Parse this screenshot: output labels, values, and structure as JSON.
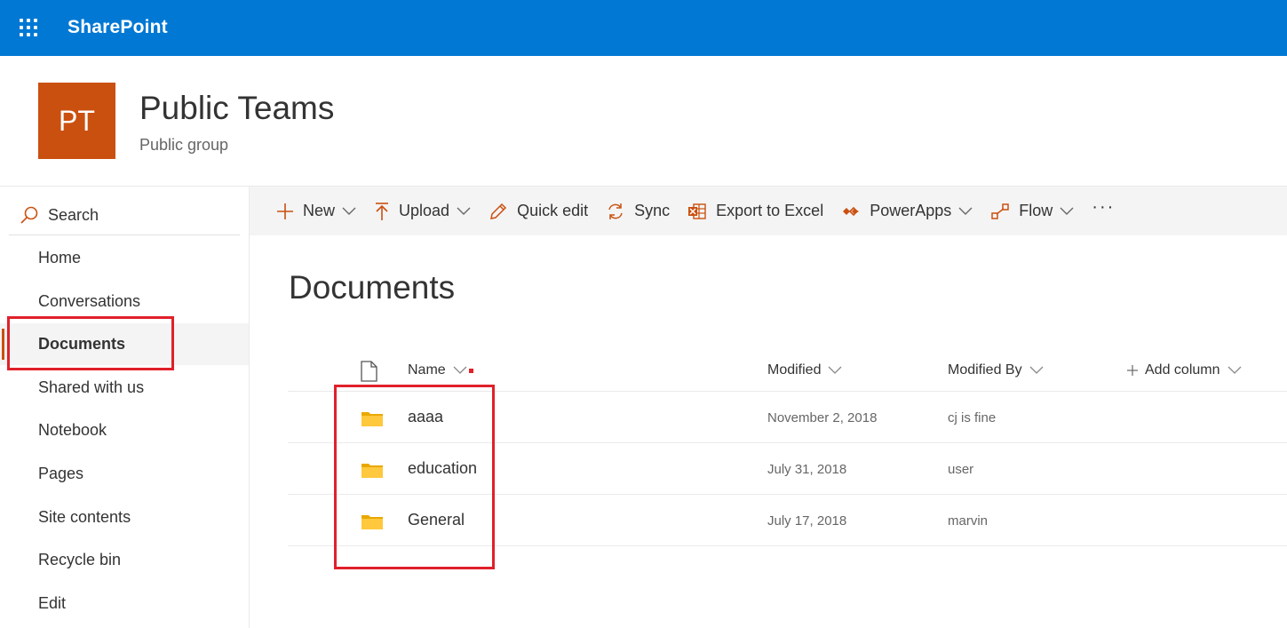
{
  "suite": {
    "brand": "SharePoint",
    "color": "#0078d4"
  },
  "site": {
    "logo_initials": "PT",
    "logo_color": "#ca5010",
    "title": "Public Teams",
    "subtitle": "Public group"
  },
  "leftnav": {
    "search_label": "Search",
    "items": [
      {
        "label": "Home",
        "active": false
      },
      {
        "label": "Conversations",
        "active": false
      },
      {
        "label": "Documents",
        "active": true
      },
      {
        "label": "Shared with us",
        "active": false
      },
      {
        "label": "Notebook",
        "active": false
      },
      {
        "label": "Pages",
        "active": false
      },
      {
        "label": "Site contents",
        "active": false
      },
      {
        "label": "Recycle bin",
        "active": false
      },
      {
        "label": "Edit",
        "active": false
      }
    ]
  },
  "commandbar": {
    "new": "New",
    "upload": "Upload",
    "quick_edit": "Quick edit",
    "sync": "Sync",
    "export": "Export to Excel",
    "powerapps": "PowerApps",
    "flow": "Flow",
    "more": "···"
  },
  "main": {
    "title": "Documents",
    "columns": {
      "name": "Name",
      "modified": "Modified",
      "modified_by": "Modified By",
      "add_column": "Add column"
    },
    "rows": [
      {
        "name": "aaaa",
        "modified": "November 2, 2018",
        "modified_by": "cj is fine"
      },
      {
        "name": "education",
        "modified": "July 31, 2018",
        "modified_by": "user"
      },
      {
        "name": "General",
        "modified": "July 17, 2018",
        "modified_by": "marvin"
      }
    ]
  },
  "colors": {
    "accent": "#ca5010",
    "highlight": "#e0202a",
    "folder": "#ffc83d"
  }
}
